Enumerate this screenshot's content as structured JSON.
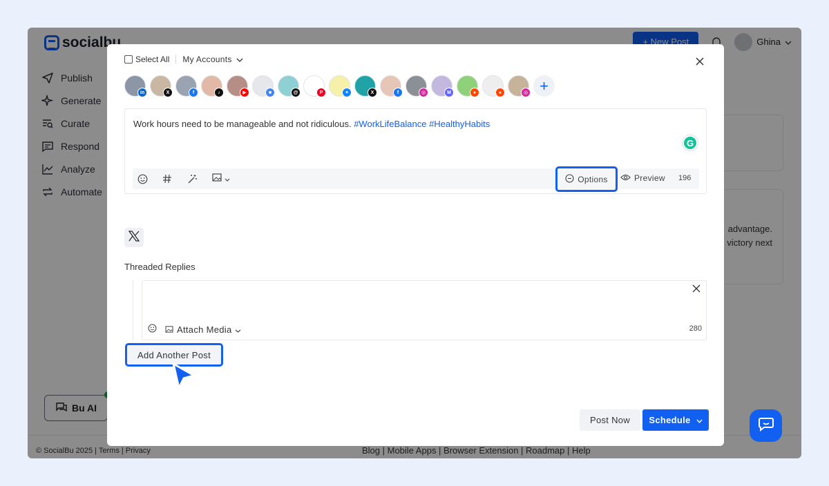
{
  "app": {
    "brand": "socialbu",
    "brand_color": "#1160f2"
  },
  "sidebar": {
    "items": [
      {
        "label": "Publish",
        "icon": "send-icon"
      },
      {
        "label": "Generate",
        "icon": "sparkle-icon"
      },
      {
        "label": "Curate",
        "icon": "curate-icon"
      },
      {
        "label": "Respond",
        "icon": "message-icon"
      },
      {
        "label": "Analyze",
        "icon": "chart-icon"
      },
      {
        "label": "Automate",
        "icon": "repeat-icon"
      }
    ],
    "bu_ai_label": "Bu AI"
  },
  "header": {
    "new_post_label": "+ New Post",
    "user_name": "Ghina"
  },
  "background_text": {
    "line1": "advantage.",
    "line2": "victory next"
  },
  "footer": {
    "left": "© SocialBu 2025 | Terms | Privacy",
    "links": "Blog | Mobile Apps | Browser Extension | Roadmap | Help"
  },
  "modal": {
    "select_all_label": "Select All",
    "my_accounts_label": "My Accounts",
    "accounts": [
      {
        "name": "socialbu-linkedin",
        "network": "linkedin",
        "badge_color": "#0a66c2",
        "avatar_color": "#8c96a6"
      },
      {
        "name": "person-x",
        "network": "x",
        "badge_color": "#111111",
        "avatar_color": "#c9b7a4"
      },
      {
        "name": "group-facebook",
        "network": "facebook",
        "badge_color": "#1877f2",
        "avatar_color": "#9aa3b2"
      },
      {
        "name": "tiktok-account",
        "network": "tiktok",
        "badge_color": "#111111",
        "avatar_color": "#e2b8a6"
      },
      {
        "name": "youtube-account",
        "network": "youtube",
        "badge_color": "#ff0000",
        "avatar_color": "#b68e86"
      },
      {
        "name": "google-business",
        "network": "google",
        "badge_color": "#4285f4",
        "avatar_color": "#e6e7ea"
      },
      {
        "name": "threads-account",
        "network": "threads",
        "badge_color": "#111111",
        "avatar_color": "#8fd0d4"
      },
      {
        "name": "socialbu-pinterest",
        "network": "pinterest",
        "badge_color": "#e60023",
        "avatar_color": "#ffffff"
      },
      {
        "name": "bluesky-account",
        "network": "bluesky",
        "badge_color": "#1185fe",
        "avatar_color": "#f6f0a8"
      },
      {
        "name": "teal-x",
        "network": "x",
        "badge_color": "#111111",
        "avatar_color": "#1fa3a7"
      },
      {
        "name": "person-facebook",
        "network": "facebook",
        "badge_color": "#1877f2",
        "avatar_color": "#e8c6b7"
      },
      {
        "name": "dark-instagram",
        "network": "instagram",
        "badge_color": "#d6249f",
        "avatar_color": "#8b8f96"
      },
      {
        "name": "flower-mastodon",
        "network": "mastodon",
        "badge_color": "#6364ff",
        "avatar_color": "#c5b8de"
      },
      {
        "name": "green-reddit",
        "network": "reddit",
        "badge_color": "#ff4500",
        "avatar_color": "#8fd17a"
      },
      {
        "name": "blank-reddit",
        "network": "reddit",
        "badge_color": "#ff4500",
        "avatar_color": "#eeeeee"
      },
      {
        "name": "photo-instagram",
        "network": "instagram",
        "badge_color": "#d6249f",
        "avatar_color": "#c7b29a"
      }
    ],
    "post_text": "Work hours need to be manageable and not ridiculous.",
    "hashtags": "#WorkLifeBalance #HealthyHabits",
    "options_label": "Options",
    "preview_label": "Preview",
    "char_count": "196",
    "threaded_replies_label": "Threaded Replies",
    "attach_media_label": "Attach Media",
    "reply_char_count": "280",
    "add_another_post_label": "Add Another Post",
    "post_now_label": "Post Now",
    "schedule_label": "Schedule"
  }
}
